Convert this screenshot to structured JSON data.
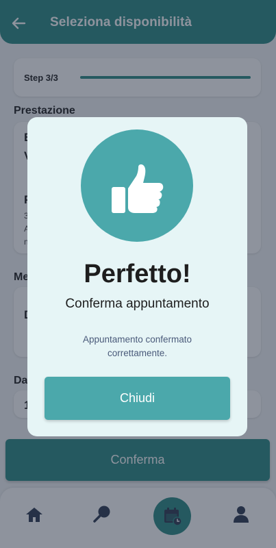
{
  "header": {
    "title": "Seleziona disponibilità",
    "back_icon": "arrow-left-icon"
  },
  "step": {
    "label": "Step 3/3",
    "progress": 1.0
  },
  "sections": {
    "prestazione": {
      "label": "Prestazione",
      "line1": "E",
      "line2": "V",
      "line3": "P",
      "small1": "3",
      "small2": "A",
      "small3": "n"
    },
    "medico": {
      "label": "Me",
      "value": "D"
    },
    "data": {
      "label": "Da",
      "value": "1"
    }
  },
  "confirm_button": {
    "label": "Conferma"
  },
  "tabbar": {
    "items": [
      {
        "icon": "home-icon",
        "active": false
      },
      {
        "icon": "search-icon",
        "active": false
      },
      {
        "icon": "calendar-icon",
        "active": true
      },
      {
        "icon": "user-icon",
        "active": false
      }
    ]
  },
  "modal": {
    "icon": "thumbs-up-icon",
    "title": "Perfetto!",
    "subtitle": "Conferma appuntamento",
    "message": "Appuntamento confermato correttamente.",
    "close_label": "Chiudi"
  },
  "colors": {
    "primary": "#2d8a84",
    "accent": "#4ba8ab",
    "modal_bg": "#e6f5f6",
    "message_text": "#4a5a7a"
  }
}
